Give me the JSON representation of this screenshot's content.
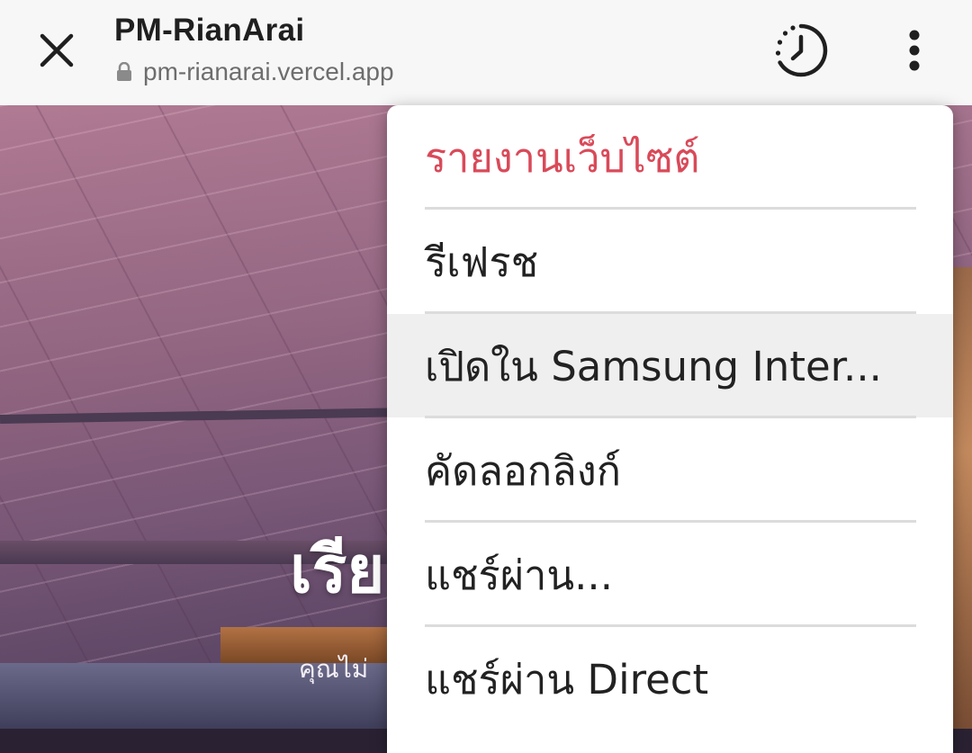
{
  "header": {
    "title": "PM-RianArai",
    "url": "pm-rianarai.vercel.app",
    "close_icon": "close-icon",
    "lock_icon": "lock-icon",
    "history_icon": "history-clock-icon",
    "more_icon": "more-vertical-icon"
  },
  "page": {
    "hero_title": "เรีย",
    "hero_subtitle": "คุณไม่"
  },
  "menu": {
    "items": [
      {
        "label": "รายงานเว็บไซต์"
      },
      {
        "label": "รีเฟรช"
      },
      {
        "label": "เปิดใน Samsung Inter..."
      },
      {
        "label": "คัดลอกลิงก์"
      },
      {
        "label": "แชร์ผ่าน..."
      },
      {
        "label": "แชร์ผ่าน Direct"
      }
    ]
  },
  "colors": {
    "danger": "#d94a59",
    "highlight": "#efefef",
    "toolbar": "#f7f7f7"
  }
}
